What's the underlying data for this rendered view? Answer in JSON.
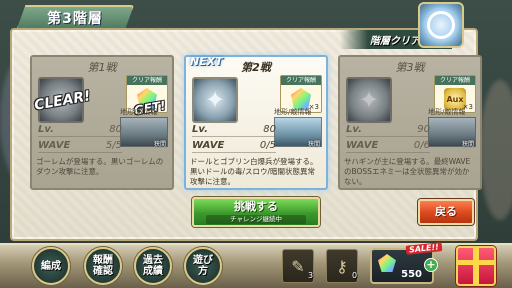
{
  "header": {
    "stage_title": "第3階層",
    "reward_label": "階層クリア報酬"
  },
  "cards": [
    {
      "title": "第1戦",
      "state": "cleared",
      "clear_stamp": "CLEAR!",
      "get_stamp": "GET!",
      "reward_label": "クリア報酬",
      "terrain_label": "地形/敵情報",
      "terrain_name": "狭間",
      "lv_label": "Lv.",
      "lv_value": "80",
      "wave_label": "WAVE",
      "wave_value": "5/5",
      "description": "ゴーレムが登場する。黒いゴーレムのダウン攻撃に注意。"
    },
    {
      "title": "第2戦",
      "state": "next",
      "next_label": "NEXT",
      "reward_label": "クリア報酬",
      "reward_count": "×3",
      "terrain_label": "地形/敵情報",
      "terrain_name": "狭間",
      "lv_label": "Lv.",
      "lv_value": "80",
      "wave_label": "WAVE",
      "wave_value": "0/5",
      "description": "ドールとゴブリン白爆兵が登場する。黒いドールの毒/スロウ/暗闇状態異常攻撃に注意。"
    },
    {
      "title": "第3戦",
      "state": "locked",
      "reward_label": "クリア報酬",
      "reward_item": "Aux",
      "reward_count": "×3",
      "terrain_label": "地形/敵情報",
      "terrain_name": "狭間",
      "lv_label": "Lv.",
      "lv_value": "90",
      "wave_label": "WAVE",
      "wave_value": "0/6",
      "description": "サハギンが主に登場する。最終WAVEのBOSSエネミーは全状態異常が効かない。"
    }
  ],
  "actions": {
    "challenge_label": "挑戦する",
    "challenge_sub": "チャレンジ継続中",
    "back_label": "戻る"
  },
  "bottom_menu": [
    {
      "label": "編成",
      "icon": "formation-icon"
    },
    {
      "label": "報酬\n確認",
      "icon": "reward-check-icon"
    },
    {
      "label": "過去\n成績",
      "icon": "history-icon"
    },
    {
      "label": "遊び\n方",
      "icon": "help-icon"
    }
  ],
  "items": [
    {
      "icon": "scroll-icon",
      "count": "3"
    },
    {
      "icon": "key-icon",
      "count": "0"
    }
  ],
  "currency": {
    "sale_label": "SALE!!",
    "stone_count": "550",
    "plus_label": "+"
  },
  "colors": {
    "accent_green": "#3c9a2d",
    "back_red": "#d94a1c",
    "panel": "#f1ece0",
    "active_border": "#7fb2d8"
  }
}
